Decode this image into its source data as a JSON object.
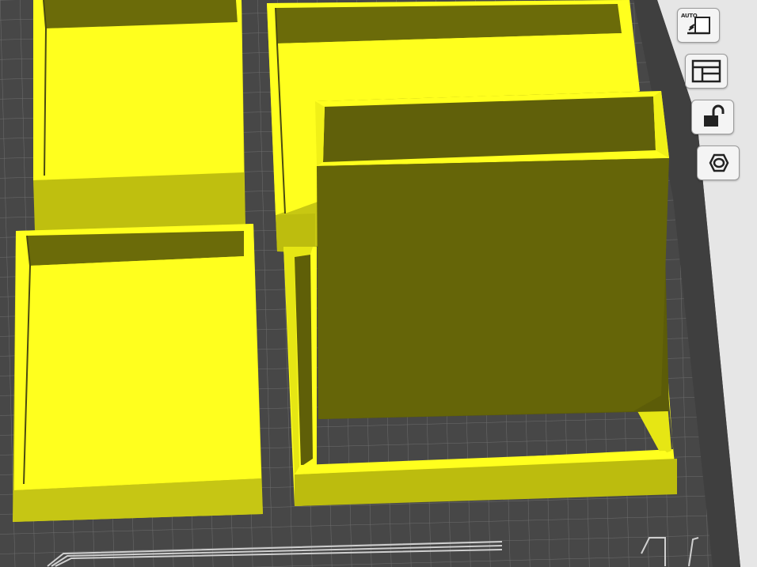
{
  "app": {
    "view": "3d-build-plate",
    "model_color": "#ffff1e",
    "plate_background": "#4a4a4a",
    "grid_color": "#7a7a7a",
    "panel_color": "#e9e9e9"
  },
  "toolbar": {
    "auto_arrange": {
      "icon": "auto-arrange-icon",
      "label": "AUTO"
    },
    "layout": {
      "icon": "layout-icon"
    },
    "lock": {
      "icon": "unlock-icon"
    },
    "settings": {
      "icon": "nut-icon"
    }
  },
  "objects": [
    {
      "name": "box-back-left"
    },
    {
      "name": "box-back-right"
    },
    {
      "name": "box-front-left"
    },
    {
      "name": "box-front-right-open-frame"
    },
    {
      "name": "box-front-right-tall"
    }
  ]
}
